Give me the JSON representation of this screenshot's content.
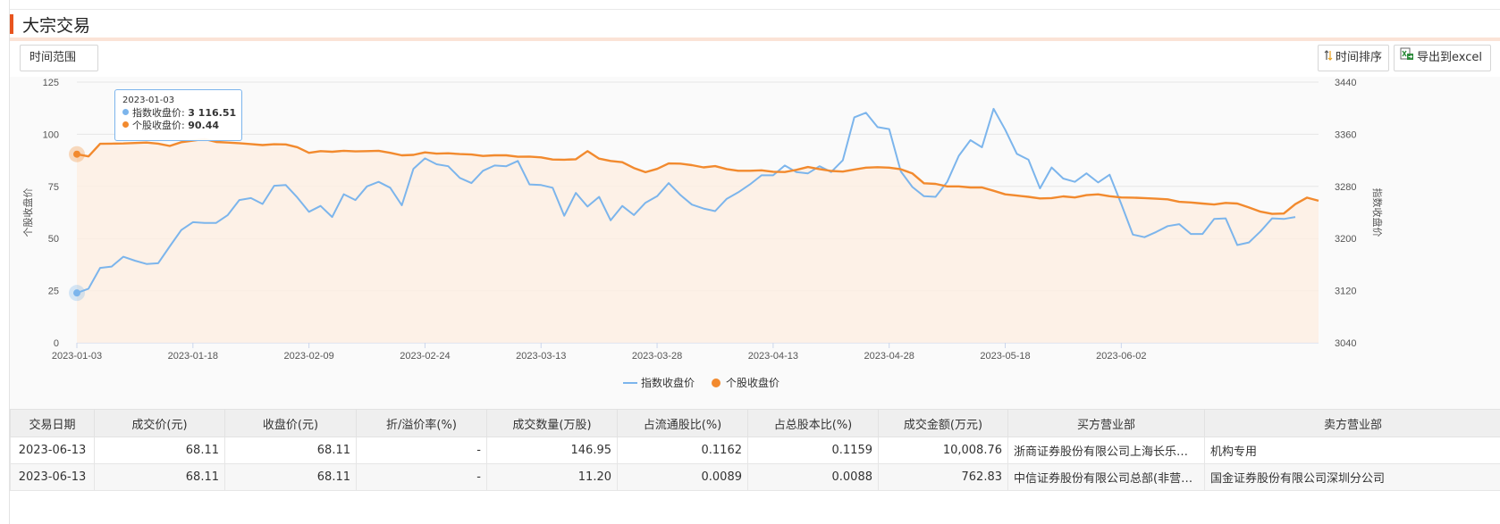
{
  "page_title": "大宗交易",
  "toolbar": {
    "range_label": "时间范围",
    "sort_label": "时间排序",
    "excel_label": "导出到excel",
    "sort_icon": "sort-arrows-icon",
    "excel_icon": "excel-export-icon"
  },
  "colors": {
    "accent": "#e8541e",
    "index_line": "#7cb5ec",
    "stock_line": "#f28a2e",
    "area_fill": "#fdeee3"
  },
  "chart_data": {
    "type": "line",
    "x_ticks": [
      "2023-01-03",
      "2023-01-18",
      "2023-02-09",
      "2023-02-24",
      "2023-03-13",
      "2023-03-28",
      "2023-04-13",
      "2023-04-28",
      "2023-05-18",
      "2023-06-02"
    ],
    "left_axis": {
      "label": "个股收盘价",
      "ticks": [
        "0",
        "25",
        "50",
        "75",
        "100",
        "125"
      ],
      "range": [
        0,
        125
      ]
    },
    "right_axis": {
      "label": "指数收盘价",
      "ticks": [
        "3040",
        "3120",
        "3200",
        "3280",
        "3360",
        "3440"
      ],
      "range": [
        3040,
        3440
      ]
    },
    "grid": true,
    "legend_position": "bottom-center",
    "series": [
      {
        "name": "指数收盘价",
        "axis": "right",
        "values": [
          3116.5,
          3123,
          3155,
          3157,
          3172,
          3166,
          3161,
          3162,
          3188,
          3213,
          3225,
          3224,
          3224,
          3236,
          3259,
          3262,
          3253,
          3281,
          3282,
          3263,
          3241,
          3250,
          3233,
          3268,
          3259,
          3280,
          3287,
          3278,
          3251,
          3307,
          3323,
          3314,
          3311,
          3293,
          3285,
          3304,
          3312,
          3311,
          3319,
          3283,
          3282,
          3278,
          3235,
          3270,
          3249,
          3264,
          3228,
          3250,
          3236,
          3255,
          3265,
          3285,
          3267,
          3252,
          3246,
          3242,
          3261,
          3271,
          3283,
          3297,
          3297,
          3312,
          3302,
          3300,
          3311,
          3302,
          3320,
          3386,
          3393,
          3371,
          3368,
          3303,
          3279,
          3265,
          3264,
          3287,
          3327,
          3351,
          3340,
          3399,
          3367,
          3330,
          3321,
          3277,
          3309,
          3292,
          3287,
          3300,
          3286,
          3298,
          3253,
          3206,
          3202,
          3210,
          3219,
          3222,
          3207,
          3207,
          3230,
          3231,
          3190,
          3194,
          3211,
          3231,
          3230,
          3233
        ]
      },
      {
        "name": "个股收盘价",
        "axis": "left",
        "values": [
          90.44,
          89.4,
          95.4,
          95.5,
          95.6,
          95.8,
          96,
          95.5,
          94.4,
          96.2,
          96.9,
          97.7,
          96.3,
          96,
          95.7,
          95.3,
          94.8,
          95.2,
          95.1,
          93.8,
          91.1,
          91.9,
          91.6,
          92.1,
          91.8,
          91.9,
          92.1,
          91.1,
          89.9,
          90.1,
          91.3,
          90.7,
          90.9,
          90.5,
          90.3,
          89.6,
          89.9,
          89.9,
          89.2,
          89.3,
          88.9,
          87.9,
          87.8,
          88,
          91.9,
          88.3,
          87.2,
          86.6,
          83.8,
          81.8,
          83.4,
          86,
          85.9,
          85.2,
          84.1,
          84.7,
          83.3,
          82.5,
          82.5,
          82.7,
          82,
          81.9,
          82.9,
          84.3,
          83.3,
          82.4,
          82.1,
          83.1,
          84,
          84.2,
          84,
          83.2,
          81.2,
          76.5,
          76.2,
          75,
          75,
          74.5,
          74.5,
          72.9,
          71.2,
          70.6,
          70,
          69.2,
          69.4,
          70.2,
          69.7,
          70.8,
          71.2,
          70.3,
          69.7,
          69.6,
          69.4,
          69.1,
          68.8,
          67.6,
          67.3,
          66.8,
          66.3,
          67.1,
          66.8,
          64.9,
          62.9,
          61.8,
          62,
          66.5,
          69.6,
          68.11
        ]
      }
    ]
  },
  "tooltip": {
    "date": "2023-01-03",
    "rows": [
      {
        "name": "指数收盘价",
        "value": "3 116.51"
      },
      {
        "name": "个股收盘价",
        "value": "90.44"
      }
    ]
  },
  "table": {
    "headers": [
      "交易日期",
      "成交价(元)",
      "收盘价(元)",
      "折/溢价率(%)",
      "成交数量(万股)",
      "占流通股比(%)",
      "占总股本比(%)",
      "成交金额(万元)",
      "买方营业部",
      "卖方营业部"
    ],
    "rows": [
      [
        "2023-06-13",
        "68.11",
        "68.11",
        "-",
        "146.95",
        "0.1162",
        "0.1159",
        "10,008.76",
        "浙商证券股份有限公司上海长乐路…",
        "机构专用"
      ],
      [
        "2023-06-13",
        "68.11",
        "68.11",
        "-",
        "11.20",
        "0.0089",
        "0.0088",
        "762.83",
        "中信证券股份有限公司总部(非营…",
        "国金证券股份有限公司深圳分公司"
      ]
    ]
  }
}
